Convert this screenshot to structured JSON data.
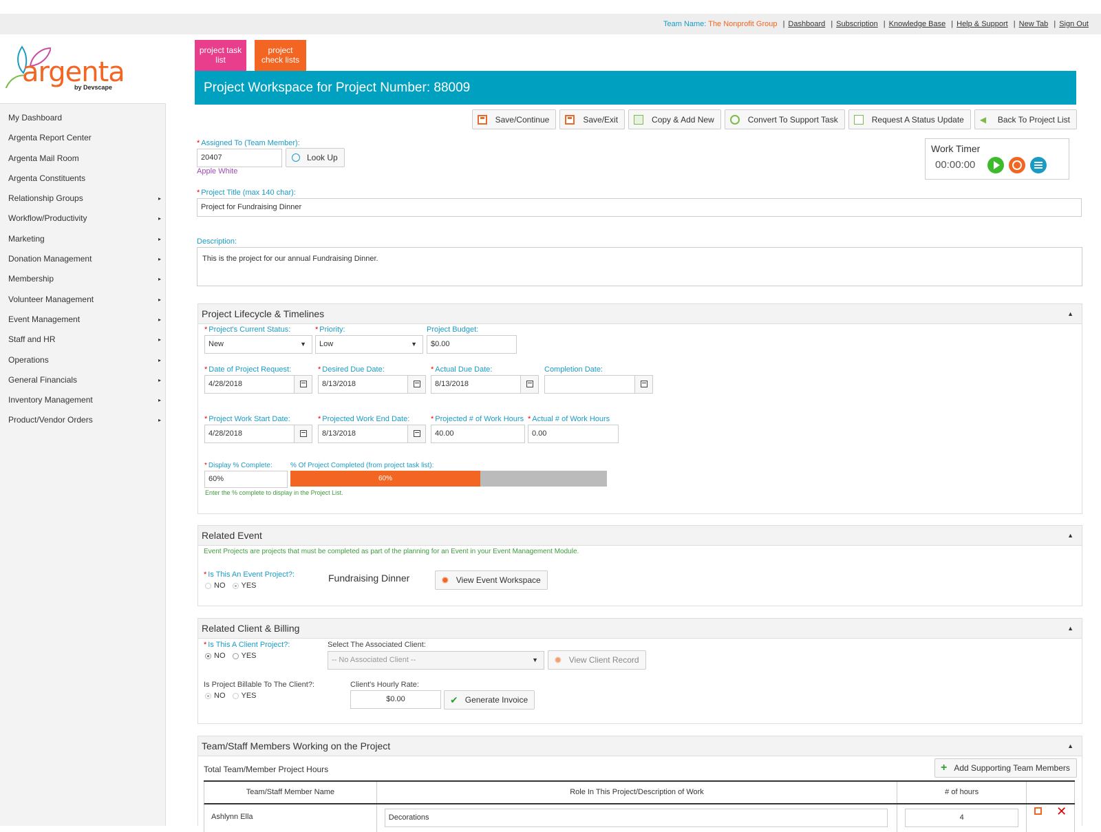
{
  "topbar": {
    "team_label": "Team Name:",
    "team_value": "The Nonprofit Group",
    "links": [
      "Dashboard",
      "Subscription",
      "Knowledge Base",
      "Help & Support",
      "New Tab",
      "Sign Out"
    ]
  },
  "logo": {
    "name": "argenta",
    "sub": "by Devscape"
  },
  "sidebar": {
    "items": [
      {
        "label": "My Dashboard",
        "arrow": ""
      },
      {
        "label": "Argenta Report Center",
        "arrow": ""
      },
      {
        "label": "Argenta Mail Room",
        "arrow": ""
      },
      {
        "label": "Argenta Constituents",
        "arrow": ""
      },
      {
        "label": "Relationship Groups",
        "arrow": "▸"
      },
      {
        "label": "Workflow/Productivity",
        "arrow": "▸"
      },
      {
        "label": "Marketing",
        "arrow": "▸"
      },
      {
        "label": "Donation Management",
        "arrow": "▸"
      },
      {
        "label": "Membership",
        "arrow": "▸"
      },
      {
        "label": "Volunteer Management",
        "arrow": "▸"
      },
      {
        "label": "Event Management",
        "arrow": "▸"
      },
      {
        "label": "Staff and HR",
        "arrow": "▸"
      },
      {
        "label": "Operations",
        "arrow": "▸"
      },
      {
        "label": "General Financials",
        "arrow": "▸"
      },
      {
        "label": "Inventory Management",
        "arrow": "▸"
      },
      {
        "label": "Product/Vendor Orders",
        "arrow": "▸"
      }
    ]
  },
  "tabs": {
    "task_list_line1": "project task",
    "task_list_line2": "list",
    "check_lists_line1": "project",
    "check_lists_line2": "check lists"
  },
  "header": {
    "title": "Project Workspace for Project Number: 88009"
  },
  "toolbar": {
    "save_continue": "Save/Continue",
    "save_exit": "Save/Exit",
    "copy_add_new": "Copy & Add New",
    "convert": "Convert To Support Task",
    "request_status": "Request A Status Update",
    "back": "Back To Project List"
  },
  "assigned": {
    "label": "Assigned To (Team Member):",
    "value": "20407",
    "lookup": "Look Up",
    "member_name": "Apple White"
  },
  "timer": {
    "title": "Work Timer",
    "time": "00:00:00"
  },
  "project_title": {
    "label": "Project Title (max 140 char):",
    "value": "Project for Fundraising Dinner"
  },
  "description": {
    "label": "Description:",
    "value": "This is the project for our annual Fundraising Dinner."
  },
  "lifecycle": {
    "title": "Project Lifecycle & Timelines",
    "status_label": "Project's Current Status:",
    "status_value": "New",
    "priority_label": "Priority:",
    "priority_value": "Low",
    "budget_label": "Project Budget:",
    "budget_value": "$0.00",
    "request_date_label": "Date of Project Request:",
    "request_date_value": "4/28/2018",
    "desired_due_label": "Desired Due Date:",
    "desired_due_value": "8/13/2018",
    "actual_due_label": "Actual Due Date:",
    "actual_due_value": "8/13/2018",
    "completion_label": "Completion Date:",
    "completion_value": "",
    "work_start_label": "Project Work Start Date:",
    "work_start_value": "4/28/2018",
    "work_end_label": "Projected Work End Date:",
    "work_end_value": "8/13/2018",
    "proj_hours_label": "Projected # of Work Hours",
    "proj_hours_value": "40.00",
    "actual_hours_label": "Actual # of Work Hours",
    "actual_hours_value": "0.00",
    "display_pct_label": "Display % Complete:",
    "display_pct_value": "60%",
    "pct_completed_label": "% Of Project Completed (from project task list):",
    "progress_text": "60%",
    "progress_fraction": 0.6,
    "hint": "Enter the % complete to display in the Project List."
  },
  "related_event": {
    "title": "Related Event",
    "note": "Event Projects are projects that must be completed as part of the planning for an Event in your Event Management Module.",
    "question": "Is This An Event Project?:",
    "no": "NO",
    "yes": "YES",
    "event_name": "Fundraising Dinner",
    "view_button": "View Event Workspace"
  },
  "client": {
    "title": "Related Client & Billing",
    "question": "Is This A Client Project?:",
    "no": "NO",
    "yes": "YES",
    "select_label": "Select The Associated Client:",
    "select_value": "-- No Associated Client --",
    "view_button": "View Client Record",
    "billable_label": "Is Project Billable To The Client?:",
    "billable_no": "NO",
    "billable_yes": "YES",
    "rate_label": "Client's Hourly Rate:",
    "rate_value": "$0.00",
    "invoice_button": "Generate Invoice"
  },
  "team": {
    "title": "Team/Staff Members Working on the Project",
    "total_label": "Total Team/Member Project Hours",
    "add_button": "Add Supporting Team Members",
    "columns": [
      "Team/Staff Member Name",
      "Role In This Project/Description of Work",
      "# of hours"
    ],
    "rows": [
      {
        "name": "Ashlynn Ella",
        "role": "Decorations",
        "hours": "4"
      }
    ]
  },
  "colors": {
    "accent_teal": "#00a0c0",
    "accent_orange": "#f26522",
    "accent_pink": "#e83e8c",
    "label_blue": "#1a9bc4"
  }
}
